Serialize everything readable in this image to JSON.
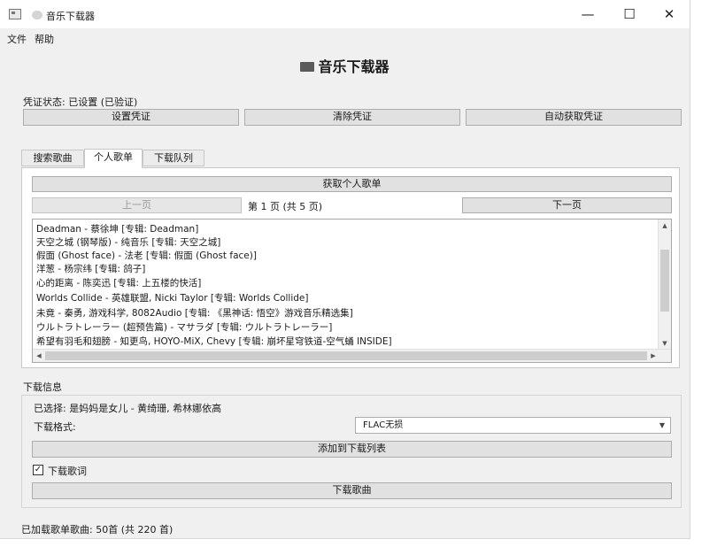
{
  "window": {
    "title": "音乐下载器",
    "controls": {
      "minimize": "—",
      "maximize": "☐",
      "close": "✕"
    }
  },
  "menu": [
    "文件",
    "帮助"
  ],
  "heading": "音乐下载器",
  "credentials": {
    "status_label": "凭证状态: 已设置 (已验证)",
    "set_button": "设置凭证",
    "clear_button": "清除凭证",
    "auto_button": "自动获取凭证"
  },
  "tabs": [
    {
      "label": "搜索歌曲",
      "active": false
    },
    {
      "label": "个人歌单",
      "active": true
    },
    {
      "label": "下载队列",
      "active": false
    }
  ],
  "playlist": {
    "fetch_button": "获取个人歌单",
    "prev_button": "上一页",
    "page_info": "第 1 页 (共 5 页)",
    "next_button": "下一页",
    "songs": [
      "Deadman - 蔡徐坤 [专辑: Deadman]",
      "天空之城 (钢琴版) - 纯音乐 [专辑: 天空之城]",
      "假面 (Ghost face) - 法老 [专辑: 假面 (Ghost face)]",
      "洋葱 - 杨宗纬 [专辑: 鸽子]",
      "心的距离 - 陈奕迅 [专辑: 上五楼的快活]",
      "Worlds Collide - 英雄联盟, Nicki Taylor [专辑: Worlds Collide]",
      "未竟 - 秦勇, 游戏科学, 8082Audio [专辑: 《黑神话: 悟空》游戏音乐精选集]",
      "ウルトラトレーラー (超预告篇) - マサラダ [专辑: ウルトラトレーラー]",
      "希望有羽毛和翅膀 - 知更鸟, HOYO-MiX, Chevy [专辑: 崩坏星穹铁道-空气蛹 INSIDE]"
    ]
  },
  "download": {
    "section_label": "下载信息",
    "selected": "已选择: 是妈妈是女儿 - 黄绮珊, 希林娜依高",
    "format_label": "下载格式:",
    "format_value": "FLAC无损",
    "add_button": "添加到下载列表",
    "lyrics_checkbox": {
      "label": "下载歌词",
      "checked": true,
      "mark": "✓"
    },
    "download_button": "下载歌曲"
  },
  "status_bar": "已加载歌单歌曲: 50首 (共 220 首)"
}
